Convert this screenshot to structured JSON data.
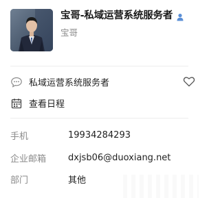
{
  "profile": {
    "name": "宝哥-私域运营系统服务者",
    "subname": "宝哥",
    "gender_icon": "person-icon"
  },
  "actions": {
    "signature_text": "私域运营系统服务者",
    "schedule_text": "查看日程",
    "icons": [
      "chat-bubble-icon",
      "calendar-icon",
      "heart-icon"
    ]
  },
  "details": [
    {
      "label": "手机",
      "value": "19934284293"
    },
    {
      "label": "企业邮箱",
      "value": "dxjsb06@duoxiang.net"
    },
    {
      "label": "部门",
      "value": "其他"
    }
  ],
  "colors": {
    "accent": "#5b8fd6",
    "label_gray": "#8a8a8a",
    "divider": "#ececec"
  }
}
